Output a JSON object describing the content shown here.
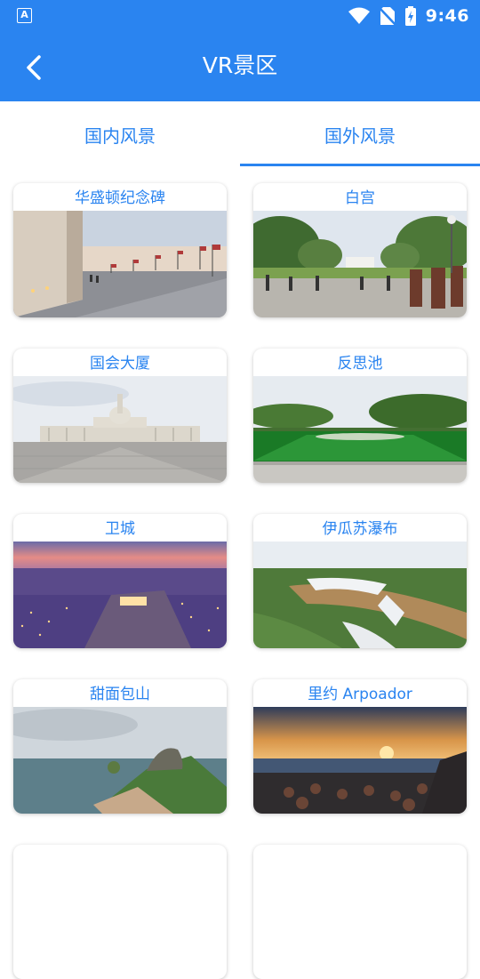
{
  "status_bar": {
    "time": "9:46",
    "left_icon_letter": "A"
  },
  "app_bar": {
    "title": "VR景区",
    "back_icon": "chevron-left-icon"
  },
  "tabs": [
    {
      "label": "国内风景",
      "selected": false
    },
    {
      "label": "国外风景",
      "selected": true
    }
  ],
  "scenic_spots": [
    {
      "name": "华盛顿纪念碑"
    },
    {
      "name": "白宫"
    },
    {
      "name": "国会大厦"
    },
    {
      "name": "反思池"
    },
    {
      "name": "卫城"
    },
    {
      "name": "伊瓜苏瀑布"
    },
    {
      "name": "甜面包山"
    },
    {
      "name": "里约 Arpoador"
    }
  ],
  "colors": {
    "accent": "#2a84f0",
    "background": "#ffffff"
  }
}
